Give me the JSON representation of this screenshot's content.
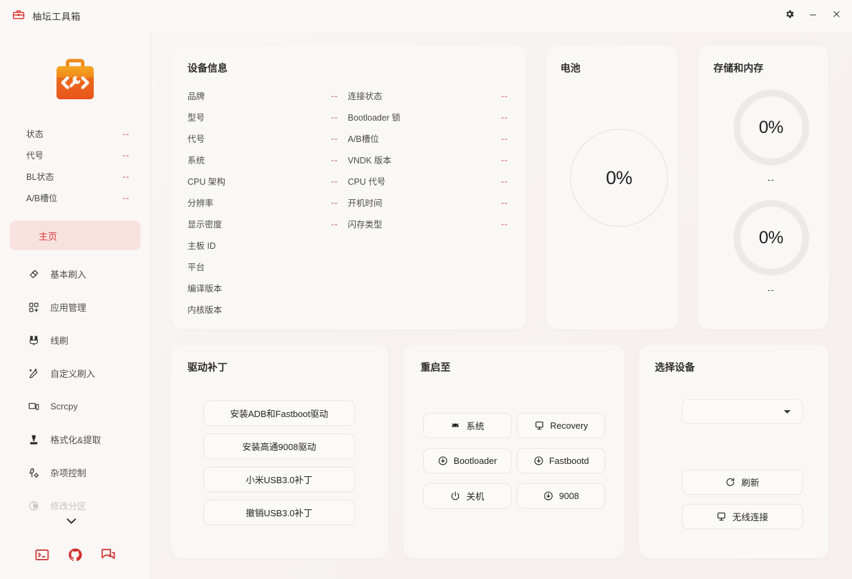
{
  "window": {
    "title": "柚坛工具箱",
    "app_icon": "toolbox-icon",
    "settings_icon": "gear-icon",
    "minimize_icon": "minimize-icon",
    "close_icon": "close-icon"
  },
  "sidebar": {
    "logo_icon": "toolbox-code-logo",
    "status": [
      {
        "label": "状态",
        "value": "--"
      },
      {
        "label": "代号",
        "value": "--"
      },
      {
        "label": "BL状态",
        "value": "--"
      },
      {
        "label": "A/B槽位",
        "value": "--"
      }
    ],
    "nav": [
      {
        "label": "主页",
        "icon": "home-icon",
        "active": true,
        "dim": false
      },
      {
        "label": "基本刷入",
        "icon": "flash-icon",
        "active": false,
        "dim": false
      },
      {
        "label": "应用管理",
        "icon": "apps-icon",
        "active": false,
        "dim": false
      },
      {
        "label": "线刷",
        "icon": "usb-icon",
        "active": false,
        "dim": false
      },
      {
        "label": "自定义刷入",
        "icon": "wand-icon",
        "active": false,
        "dim": false
      },
      {
        "label": "Scrcpy",
        "icon": "screen-icon",
        "active": false,
        "dim": false
      },
      {
        "label": "格式化&提取",
        "icon": "extract-icon",
        "active": false,
        "dim": false
      },
      {
        "label": "杂项控制",
        "icon": "tools-icon",
        "active": false,
        "dim": false
      },
      {
        "label": "修改分区",
        "icon": "partition-icon",
        "active": false,
        "dim": true
      }
    ],
    "scroll_hint_icon": "chevron-down-icon",
    "footer_icons": [
      "terminal-icon",
      "github-icon",
      "chat-icon"
    ]
  },
  "device_info": {
    "title": "设备信息",
    "left": [
      {
        "label": "品牌",
        "value": "--"
      },
      {
        "label": "型号",
        "value": "--"
      },
      {
        "label": "代号",
        "value": "--"
      },
      {
        "label": "系统",
        "value": "--"
      },
      {
        "label": "CPU 架构",
        "value": "--"
      },
      {
        "label": "分辨率",
        "value": "--"
      },
      {
        "label": "显示密度",
        "value": "--"
      },
      {
        "label": "主板 ID",
        "value": "--"
      },
      {
        "label": "平台",
        "value": "--"
      },
      {
        "label": "编译版本",
        "value": "--"
      },
      {
        "label": "内核版本",
        "value": "--"
      }
    ],
    "right": [
      {
        "label": "连接状态",
        "value": "--"
      },
      {
        "label": "Bootloader 锁",
        "value": "--"
      },
      {
        "label": "A/B槽位",
        "value": "--"
      },
      {
        "label": "VNDK 版本",
        "value": "--"
      },
      {
        "label": "CPU 代号",
        "value": "--"
      },
      {
        "label": "开机时间",
        "value": "--"
      },
      {
        "label": "闪存类型",
        "value": "--"
      },
      {
        "label": "",
        "value": ""
      },
      {
        "label": "",
        "value": ""
      },
      {
        "label": "",
        "value": ""
      },
      {
        "label": "",
        "value": ""
      }
    ]
  },
  "battery": {
    "title": "电池",
    "percent": "0%",
    "sub": "--"
  },
  "storage": {
    "title": "存储和内存",
    "rings": [
      {
        "percent": "0%",
        "sub": "--"
      },
      {
        "percent": "0%",
        "sub": "--"
      }
    ]
  },
  "driver_patch": {
    "title": "驱动补丁",
    "buttons": [
      {
        "label": "安装ADB和Fastboot驱动"
      },
      {
        "label": "安装高通9008驱动"
      },
      {
        "label": "小米USB3.0补丁"
      },
      {
        "label": "撤销USB3.0补丁"
      }
    ]
  },
  "reboot": {
    "title": "重启至",
    "buttons": [
      {
        "label": "系统",
        "icon": "android-icon"
      },
      {
        "label": "Recovery",
        "icon": "monitor-icon"
      },
      {
        "label": "Bootloader",
        "icon": "download-circle-icon"
      },
      {
        "label": "Fastbootd",
        "icon": "download-circle-icon"
      },
      {
        "label": "关机",
        "icon": "power-icon"
      },
      {
        "label": "9008",
        "icon": "download-circle-icon"
      }
    ]
  },
  "device_select": {
    "title": "选择设备",
    "selected": "",
    "dropdown_icon": "caret-down-icon",
    "refresh_label": "刷新",
    "refresh_icon": "refresh-icon",
    "wireless_label": "无线连接",
    "wireless_icon": "monitor-icon"
  },
  "colors": {
    "accent": "#d9393a",
    "value": "#c23b38",
    "card_bg": "#faf8f7",
    "page_bg": "#f6f2f1"
  }
}
